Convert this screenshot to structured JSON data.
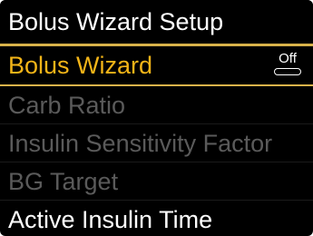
{
  "header": {
    "title": "Bolus Wizard Setup"
  },
  "menu": {
    "items": [
      {
        "label": "Bolus Wizard",
        "state": "selected",
        "toggle": "Off"
      },
      {
        "label": "Carb Ratio",
        "state": "disabled"
      },
      {
        "label": "Insulin Sensitivity Factor",
        "state": "disabled"
      },
      {
        "label": "BG Target",
        "state": "disabled"
      },
      {
        "label": "Active Insulin Time",
        "state": "enabled"
      }
    ]
  },
  "colors": {
    "background": "#000000",
    "highlight": "#f2b418",
    "rule": "#d8b24a",
    "disabled_text": "#5a5a5a",
    "text": "#ffffff"
  },
  "icons": {
    "toggle": "toggle-switch-icon"
  }
}
